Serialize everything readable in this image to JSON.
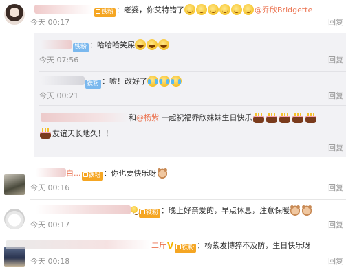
{
  "comments": [
    {
      "badge": "铁粉",
      "text": "：老婆，你艾特错了",
      "mention": "@乔欣Bridgette",
      "time": "今天 00:17",
      "reply": "回复",
      "replies": [
        {
          "badge": "铁粉",
          "text": "：哈哈哈笑屎",
          "time": "今天 07:56",
          "reply": "回复"
        },
        {
          "badge": "铁粉",
          "text": "：嘘！改好了",
          "time": "今天 00:21",
          "reply": "回复"
        },
        {
          "prefix": "和",
          "mention": "@杨紫",
          "text": " 一起祝福乔欣妹妹生日快乐",
          "text2": "友谊天长地久！！",
          "reply": "回复"
        }
      ]
    },
    {
      "name_suffix": "白...",
      "badge": "铁粉",
      "text": "：你也要快乐呀",
      "time": "今天 00:16",
      "reply": "回复"
    },
    {
      "badge": "铁粉",
      "text": "：晚上好亲爱的，早点休息，注意保暖",
      "time": "今天 00:17",
      "reply": "回复"
    },
    {
      "name_suffix": "二斤",
      "badge": "铁粉",
      "text": "：杨紫发博猝不及防，生日快乐呀",
      "time": "今天 00:18",
      "reply": "回复"
    }
  ],
  "icons": {
    "smile_emoji": "smile-emoji-icon",
    "laugh_emoji": "laugh-emoji-icon",
    "cry_emoji": "cry-laugh-emoji-icon",
    "cake_emoji": "birthday-cake-icon",
    "bear_emoji": "bear-emoji-icon",
    "vip": "vip-v-icon"
  },
  "colors": {
    "mention": "#eb7350",
    "meta": "#939393",
    "badge_orange": "#f5a623",
    "badge_blue": "#7ab8ee",
    "sub_bg": "#f2f2f5"
  }
}
